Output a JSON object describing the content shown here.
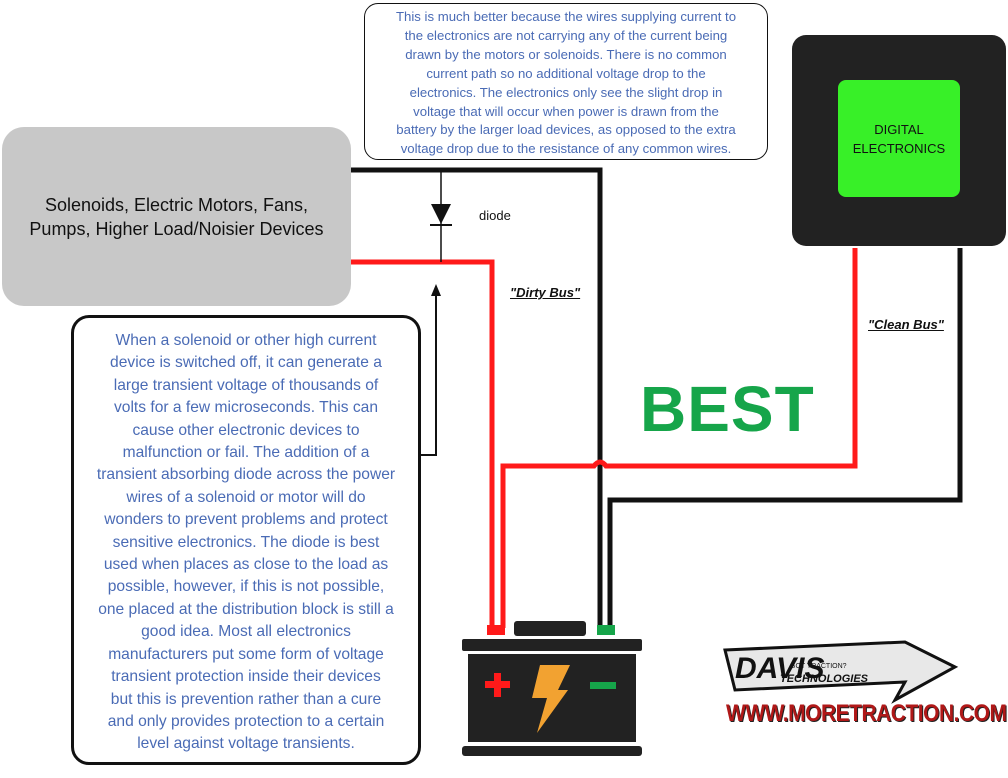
{
  "top_note": {
    "lines": [
      "This is  much better because  the wires supplying current to",
      "the electronics are not carrying any of the current being",
      "drawn by the motors or solenoids. There is no common",
      "current path so no additional voltage drop to the",
      "electronics.  The electronics only  see the slight drop in",
      "voltage that will occur when power is drawn from the",
      "battery by the larger load devices, as opposed to the extra",
      "voltage drop due to the resistance of any common wires."
    ]
  },
  "load_box": {
    "lines": [
      "Solenoids, Electric Motors, Fans,",
      "Pumps, Higher Load/Noisier Devices"
    ]
  },
  "digital_box": {
    "lines": [
      "DIGITAL",
      "ELECTRONICS"
    ],
    "color": "#38f028"
  },
  "diode_label": "diode",
  "dirty_bus_label": "\"Dirty Bus\"",
  "clean_bus_label": "\"Clean Bus\"",
  "best_label": "BEST",
  "bottom_note": {
    "lines": [
      "When a solenoid or other high current",
      "device is switched off, it can generate a",
      "large transient voltage of thousands of",
      "volts for a few microseconds.  This can",
      "cause other electronic devices to",
      "malfunction or fail.   The addition of a",
      "transient absorbing diode across the power",
      "wires of a solenoid or motor will do",
      "wonders to prevent problems and protect",
      "sensitive electronics.  The diode is best",
      "used when places as close to the load as",
      "possible, however, if this is not possible,",
      "one placed at the distribution block is still a",
      "good idea.  Most all electronics",
      "manufacturers put some form of voltage",
      "transient protection inside their devices",
      "but this is prevention rather than a cure",
      "and only provides protection to a certain",
      "level against voltage transients."
    ]
  },
  "battery": {
    "plus": "+",
    "minus": "−",
    "icon": "lightning-bolt-icon"
  },
  "logo": {
    "brand": "DAVIS",
    "tagline": "GOT TRACTION?",
    "sub": "TECHNOLOGIES",
    "url": "WWW.MORETRACTION.COM"
  },
  "colors": {
    "positive_wire": "#ff1a1a",
    "negative_wire": "#111111",
    "note_text": "#4a6bb5",
    "best": "#16a54a"
  }
}
